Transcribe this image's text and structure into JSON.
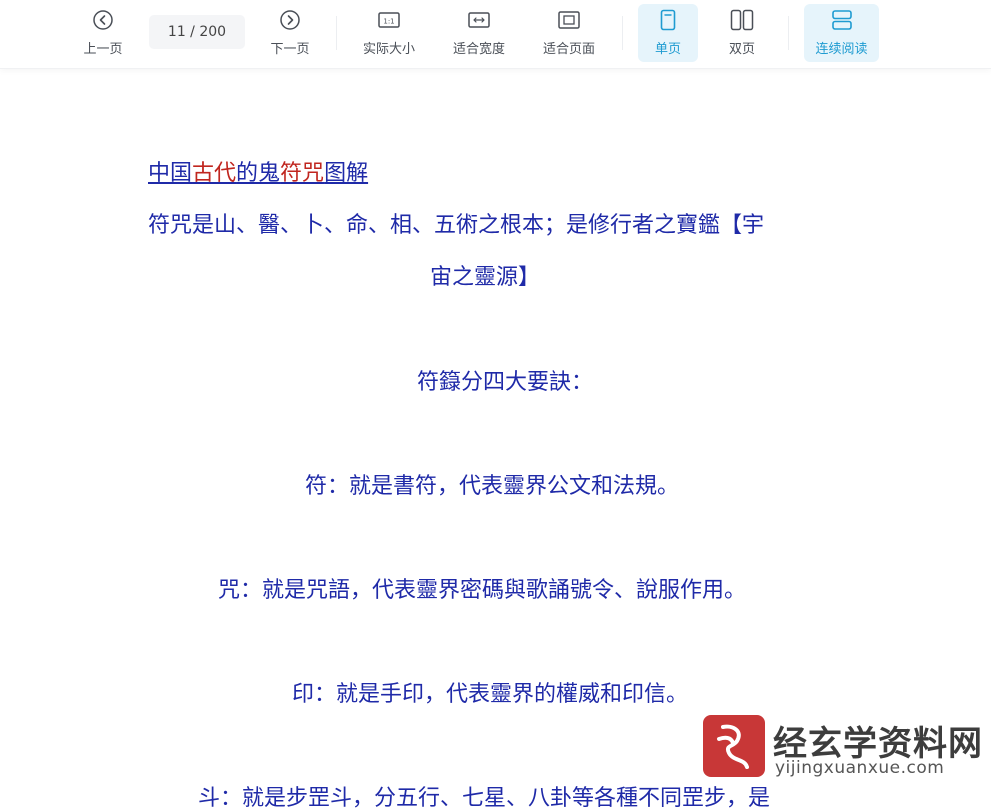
{
  "toolbar": {
    "prev_label": "上一页",
    "next_label": "下一页",
    "page_current": "11",
    "page_separator": " / ",
    "page_total": "200",
    "actual_size_label": "实际大小",
    "fit_width_label": "适合宽度",
    "fit_page_label": "适合页面",
    "single_page_label": "单页",
    "double_page_label": "双页",
    "continuous_label": "连续阅读",
    "active_view": "单页",
    "active_color": "#1f9bd1"
  },
  "document": {
    "title": {
      "part1": "中国",
      "part2": "古代",
      "part3": "的鬼",
      "part4": "符咒",
      "part5": "图解"
    },
    "paragraphs": [
      "符咒是山、醫、卜、命、相、五術之根本；是修行者之寶鑑【宇",
      "宙之靈源】",
      "符籙分四大要訣：",
      "符：就是書符，代表靈界公文和法規。",
      "咒：就是咒語，代表靈界密碼與歌誦號令、說服作用。",
      "印：就是手印，代表靈界的權威和印信。",
      "斗：就是步罡斗，分五行、七星、八卦等各種不同罡步，是"
    ],
    "text_color": "#1f2aa8",
    "highlight_color": "#c0261f"
  },
  "watermark": {
    "title": "经玄学资料网",
    "url": "yijingxuanxue.com"
  }
}
